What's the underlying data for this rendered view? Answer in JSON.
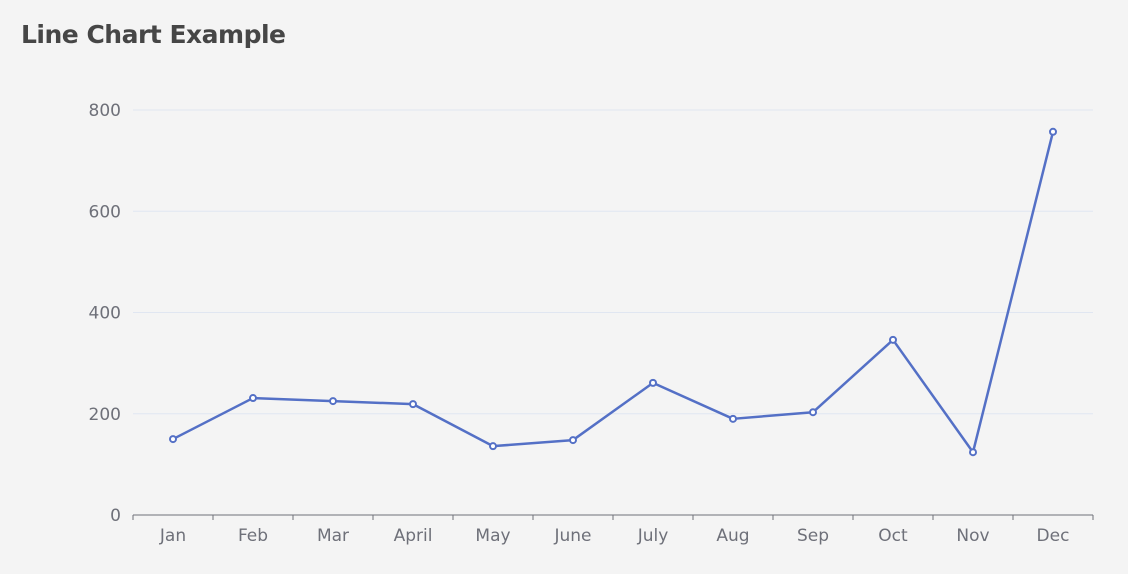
{
  "chart_data": {
    "type": "line",
    "title": "Line Chart Example",
    "categories": [
      "Jan",
      "Feb",
      "Mar",
      "April",
      "May",
      "June",
      "July",
      "Aug",
      "Sep",
      "Oct",
      "Nov",
      "Dec"
    ],
    "values": [
      150,
      231,
      225,
      219,
      136,
      148,
      261,
      190,
      203,
      346,
      124,
      757
    ],
    "xlabel": "",
    "ylabel": "",
    "ylim": [
      0,
      800
    ],
    "yticks": [
      0,
      200,
      400,
      600,
      800
    ],
    "grid": true,
    "color": "#5470c6"
  }
}
